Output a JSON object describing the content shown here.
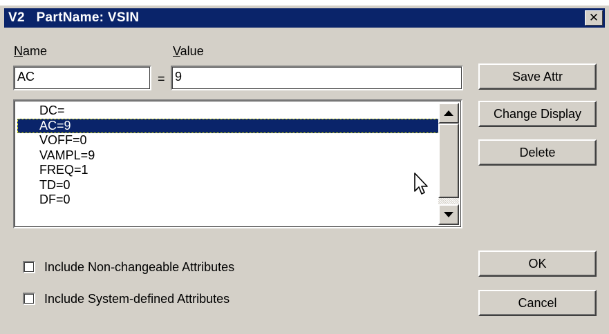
{
  "title": "V2   PartName: VSIN",
  "labels": {
    "name": "Name",
    "value": "Value",
    "equals": "="
  },
  "fields": {
    "name_value": "AC",
    "value_value": "9"
  },
  "attributes": [
    {
      "text": "DC=",
      "selected": false
    },
    {
      "text": "AC=9",
      "selected": true
    },
    {
      "text": "VOFF=0",
      "selected": false
    },
    {
      "text": "VAMPL=9",
      "selected": false
    },
    {
      "text": "FREQ=1",
      "selected": false
    },
    {
      "text": "TD=0",
      "selected": false
    },
    {
      "text": "DF=0",
      "selected": false
    }
  ],
  "buttons": {
    "save_attr": "Save Attr",
    "change_display": "Change Display",
    "delete": "Delete",
    "ok": "OK",
    "cancel": "Cancel"
  },
  "checkboxes": {
    "non_changeable": {
      "label": "Include Non-changeable Attributes",
      "checked": false
    },
    "system_defined": {
      "label": "Include System-defined Attributes",
      "checked": false
    }
  },
  "icons": {
    "close": "close-icon",
    "scroll_up": "scroll-up-arrow-icon",
    "scroll_down": "scroll-down-arrow-icon",
    "cursor": "mouse-pointer-icon"
  },
  "colors": {
    "titlebar": "#0a246a",
    "dialog_bg": "#d4d0c8",
    "selection": "#0a246a"
  }
}
